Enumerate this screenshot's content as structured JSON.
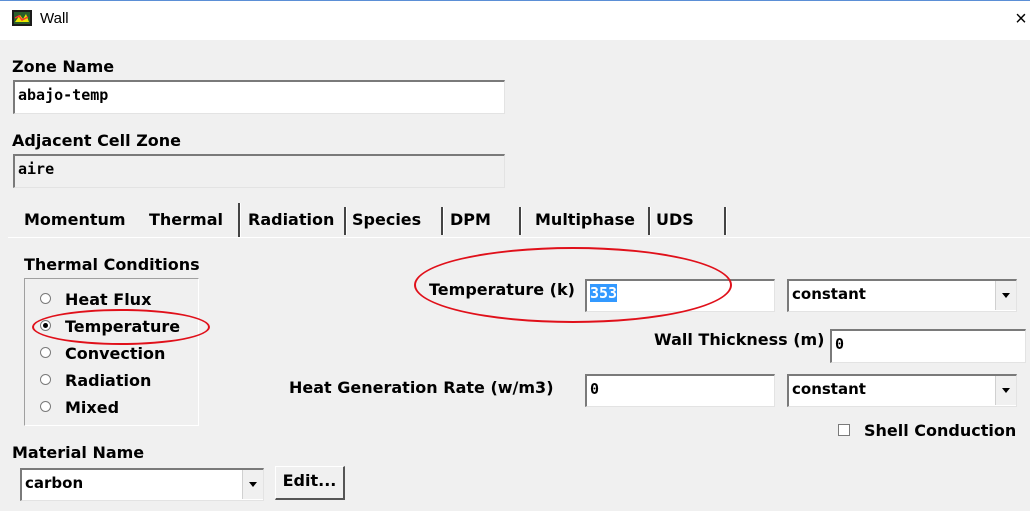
{
  "window": {
    "title": "Wall",
    "close_glyph": "×",
    "icon": "fluent-app-icon"
  },
  "zone_name": {
    "label": "Zone Name",
    "value": "abajo-temp"
  },
  "adjacent_cell_zone": {
    "label": "Adjacent Cell Zone",
    "value": "aire"
  },
  "tabs": [
    {
      "label": "Momentum",
      "selected": false
    },
    {
      "label": "Thermal",
      "selected": true
    },
    {
      "label": "Radiation",
      "selected": false
    },
    {
      "label": "Species",
      "selected": false
    },
    {
      "label": "DPM",
      "selected": false
    },
    {
      "label": "Multiphase",
      "selected": false
    },
    {
      "label": "UDS",
      "selected": false
    }
  ],
  "thermal_conditions": {
    "label": "Thermal Conditions",
    "options": [
      {
        "label": "Heat Flux",
        "selected": false
      },
      {
        "label": "Temperature",
        "selected": true
      },
      {
        "label": "Convection",
        "selected": false
      },
      {
        "label": "Radiation",
        "selected": false
      },
      {
        "label": "Mixed",
        "selected": false
      }
    ]
  },
  "temperature": {
    "label": "Temperature (k)",
    "value": "353",
    "method": "constant"
  },
  "wall_thickness": {
    "label": "Wall Thickness (m)",
    "value": "0"
  },
  "heat_generation": {
    "label": "Heat Generation Rate (w/m3)",
    "value": "0",
    "method": "constant"
  },
  "shell_conduction": {
    "label": "Shell Conduction",
    "checked": false
  },
  "material": {
    "label": "Material Name",
    "value": "carbon",
    "edit_label": "Edit..."
  },
  "annotation_color": "#e0101a",
  "selection_color": "#3399ff"
}
